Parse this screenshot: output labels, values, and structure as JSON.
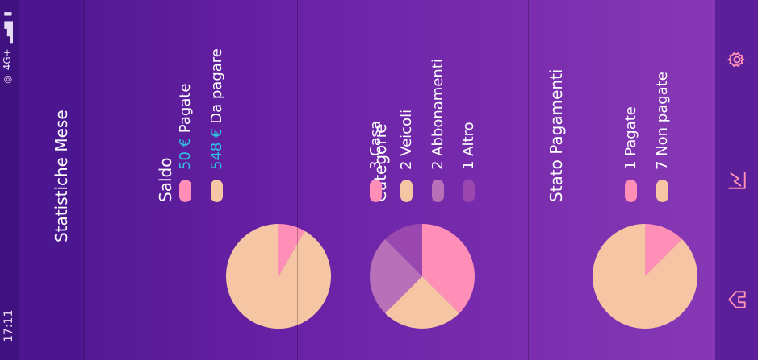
{
  "status": {
    "time": "17:11",
    "network": "4G+"
  },
  "header": {
    "title": "Statistiche Mese"
  },
  "cards": [
    {
      "title": "Saldo",
      "legend": [
        {
          "value": "50 €",
          "label": "Pagate",
          "color": "#ff8fb6"
        },
        {
          "value": "548 €",
          "label": "Da pagare",
          "color": "#f6c6a4"
        }
      ],
      "slices": [
        50,
        548
      ]
    },
    {
      "title": "Categorie",
      "legend": [
        {
          "value": "3",
          "label": "Casa",
          "color": "#ff8fb6"
        },
        {
          "value": "2",
          "label": "Veicoli",
          "color": "#f6c6a4"
        },
        {
          "value": "2",
          "label": "Abbonamenti",
          "color": "#b870b8"
        },
        {
          "value": "1",
          "label": "Altro",
          "color": "#9a48b0"
        }
      ],
      "slices": [
        3,
        2,
        2,
        1
      ]
    },
    {
      "title": "Stato Pagamenti",
      "legend": [
        {
          "value": "1",
          "label": "Pagate",
          "color": "#ff8fb6"
        },
        {
          "value": "7",
          "label": "Non pagate",
          "color": "#f6c6a4"
        }
      ],
      "slices": [
        1,
        7
      ]
    }
  ],
  "nav": {
    "icons": [
      "home-icon",
      "chart-icon",
      "gear-icon"
    ],
    "accent": "#ff8fb6"
  }
}
